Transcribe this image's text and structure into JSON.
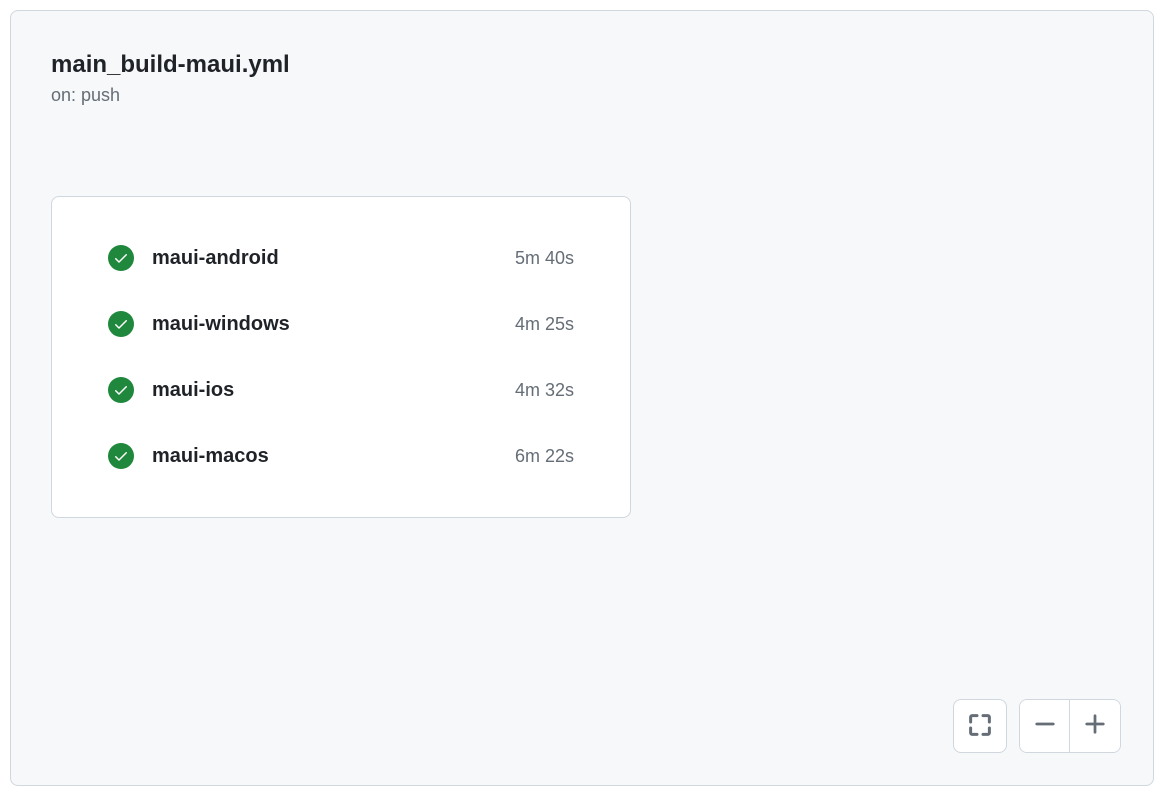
{
  "workflow": {
    "title": "main_build-maui.yml",
    "trigger": "on: push"
  },
  "jobs": [
    {
      "name": "maui-android",
      "duration": "5m 40s",
      "status": "success"
    },
    {
      "name": "maui-windows",
      "duration": "4m 25s",
      "status": "success"
    },
    {
      "name": "maui-ios",
      "duration": "4m 32s",
      "status": "success"
    },
    {
      "name": "maui-macos",
      "duration": "6m 22s",
      "status": "success"
    }
  ],
  "colors": {
    "success": "#1f883d",
    "panel_bg": "#f6f8fa",
    "border": "#d0d7de",
    "text_primary": "#1f2328",
    "text_muted": "#656d76"
  }
}
